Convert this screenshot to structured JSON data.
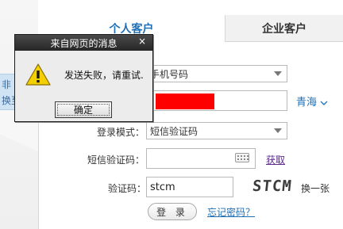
{
  "background": {
    "left_text_1": "非",
    "left_text_2": "换至"
  },
  "tabs": {
    "personal": "个人客户",
    "enterprise": "企业客户"
  },
  "form": {
    "account_type_value": "手机号码",
    "login_mode_label": "登录模式：",
    "login_mode_value": "短信验证码",
    "region_link": "青海",
    "sms_code_label": "短信验证码：",
    "sms_code_value": "",
    "get_sms_code_link": "获取",
    "captcha_label": "验证码：",
    "captcha_value": "stcm",
    "captcha_image_text": "STCM",
    "captcha_refresh_label": "换一张",
    "login_button_label": "登 录",
    "forgot_password_link": "忘记密码？"
  },
  "dialog": {
    "title": "来自网页的消息",
    "close_glyph": "×",
    "message": "发送失败，请重试.",
    "ok_label": "确定"
  },
  "colors": {
    "accent_blue": "#1f6fb5",
    "redaction": "#ff0000",
    "dialog_titlebar": "#2f2f2f"
  },
  "icons": {
    "dialog": "warning-icon",
    "keyboard": "keyboard-icon",
    "region": "chevron-down-icon"
  }
}
